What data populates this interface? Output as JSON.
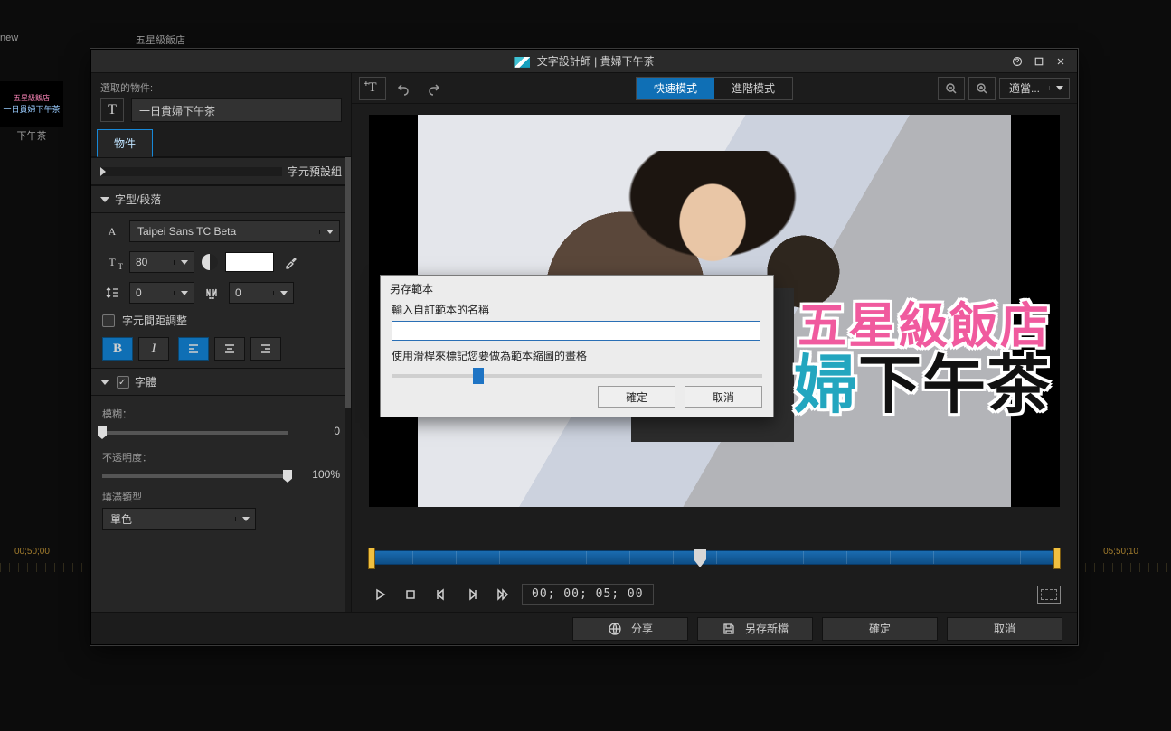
{
  "app": {
    "designerLabel": "文字設計師",
    "projectName": "貴婦下午茶",
    "titleSeparator": " | "
  },
  "background": {
    "templateLabelTop": "五星級飯店",
    "newLabel": "new",
    "thumbLabel": "下午茶",
    "thumbLine1": "五星級飯店",
    "thumbLine2": "一日貴婦下午茶",
    "timecodeLeft": "00;50;00",
    "timecodeRight": "05;50;10"
  },
  "leftPanel": {
    "selectedLabel": "選取的物件:",
    "titleValue": "一日貴婦下午茶",
    "tab": "物件",
    "sections": {
      "presets": "字元預設組",
      "font": "字型/段落",
      "body": "字體"
    },
    "font": {
      "family": "Taipei Sans TC Beta",
      "size": "80",
      "lineSpacing": "0",
      "tracking": "0",
      "kerningLabel": "字元間距調整"
    },
    "bodyFx": {
      "blurLabel": "模糊：",
      "blurValue": "0",
      "opacityLabel": "不透明度：",
      "opacityValue": "100%",
      "fillTypeLabel": "填滿類型",
      "fillType": "單色"
    }
  },
  "toolbar": {
    "modeFast": "快速模式",
    "modeAdvanced": "進階模式",
    "fitLabel": "適當..."
  },
  "previewTitle": {
    "line1": "五星級飯店",
    "line2a": "婦",
    "line2b": "下午茶"
  },
  "playback": {
    "timecode": "00; 00; 05; 00"
  },
  "footer": {
    "share": "分享",
    "saveAs": "另存新檔",
    "ok": "確定",
    "cancel": "取消"
  },
  "saveDialog": {
    "title": "另存範本",
    "prompt": "輸入自訂範本的名稱",
    "hint": "使用滑桿來標記您要做為範本縮圖的畫格",
    "ok": "確定",
    "cancel": "取消"
  }
}
